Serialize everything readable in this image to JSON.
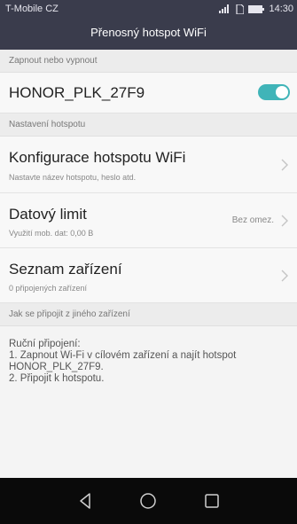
{
  "status_bar": {
    "carrier": "T-Mobile CZ",
    "time": "14:30"
  },
  "title_bar": {
    "title": "Přenosný hotspot WiFi"
  },
  "section_toggle": {
    "header": "Zapnout nebo vypnout",
    "network_name": "HONOR_PLK_27F9",
    "enabled": true
  },
  "section_settings": {
    "header": "Nastavení hotspotu",
    "items": [
      {
        "title": "Konfigurace hotspotu WiFi",
        "subtitle": "Nastavte název hotspotu, heslo atd.",
        "value": ""
      },
      {
        "title": "Datový limit",
        "subtitle": "Využití mob. dat: 0,00 B",
        "value": "Bez omez."
      },
      {
        "title": "Seznam zařízení",
        "subtitle": "0 připojených zařízení",
        "value": ""
      }
    ]
  },
  "section_connect": {
    "header": "Jak se připojit z jiného zařízení",
    "lines": [
      "Ruční připojení:",
      "1. Zapnout Wi-Fi v cílovém zařízení a najít hotspot",
      "HONOR_PLK_27F9.",
      "2. Připojit k hotspotu."
    ]
  },
  "colors": {
    "bar": "#3a3c4c",
    "accent": "#40b4b8",
    "nav": "#0a0a0a"
  },
  "icons": [
    "signal-icon",
    "sim-icon",
    "battery-icon",
    "chevron-right-icon",
    "back-icon",
    "home-icon",
    "recents-icon"
  ]
}
